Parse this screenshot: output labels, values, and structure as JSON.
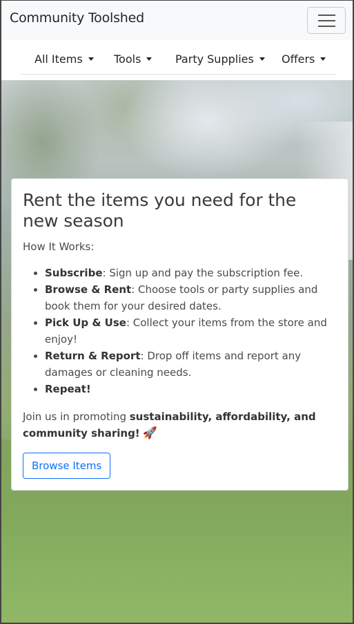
{
  "navbar": {
    "brand": "Community Toolshed",
    "toggler_icon": "hamburger-icon"
  },
  "nav": {
    "items": [
      {
        "label": "All Items"
      },
      {
        "label": "Tools"
      },
      {
        "label": "Party Supplies"
      },
      {
        "label": "Offers"
      }
    ]
  },
  "hero": {
    "title": "Rent the items you need for the new season",
    "how_label": "How It Works:",
    "steps": [
      {
        "bold": "Subscribe",
        "text": ": Sign up and pay the subscription fee."
      },
      {
        "bold": "Browse & Rent",
        "text": ": Choose tools or party supplies and book them for your desired dates."
      },
      {
        "bold": "Pick Up & Use",
        "text": ": Collect your items from the store and enjoy!"
      },
      {
        "bold": "Return & Report",
        "text": ": Drop off items and report any damages or cleaning needs."
      },
      {
        "bold": "Repeat!",
        "text": ""
      }
    ],
    "join_prefix": "Join us in promoting ",
    "join_bold": "sustainability, affordability, and community sharing!",
    "join_emoji": "🚀",
    "button_label": "Browse Items"
  },
  "colors": {
    "primary": "#0d6efd",
    "navbar_bg": "#f8f9fa"
  }
}
